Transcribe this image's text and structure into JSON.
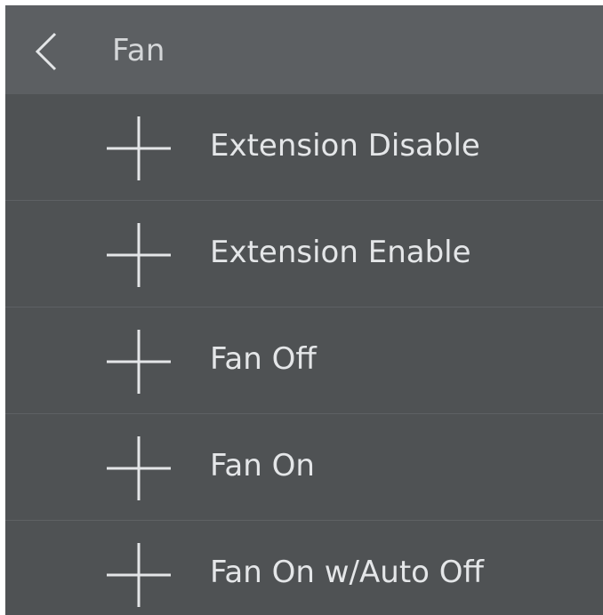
{
  "header": {
    "back_icon": "chevron-left-icon",
    "title": "Fan"
  },
  "items": [
    {
      "icon": "plus-icon",
      "label": "Extension Disable"
    },
    {
      "icon": "plus-icon",
      "label": "Extension Enable"
    },
    {
      "icon": "plus-icon",
      "label": "Fan Off"
    },
    {
      "icon": "plus-icon",
      "label": "Fan On"
    },
    {
      "icon": "plus-icon",
      "label": "Fan On w/Auto Off"
    }
  ],
  "colors": {
    "header_bg": "#5c5f62",
    "list_bg": "#4f5254",
    "text": "#e4e6e8"
  }
}
